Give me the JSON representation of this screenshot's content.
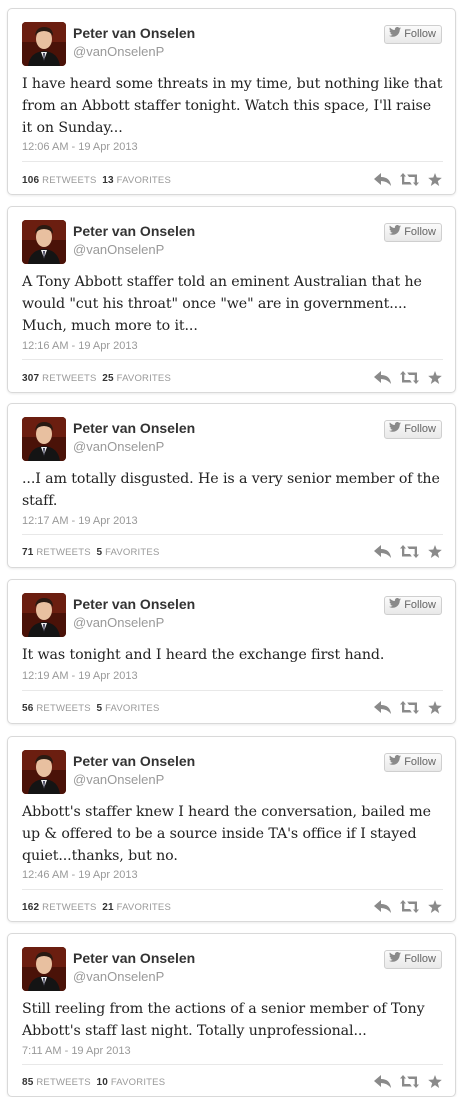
{
  "labels": {
    "follow": "Follow",
    "retweets": "RETWEETS",
    "favorites": "FAVORITES"
  },
  "colors": {
    "icon_gray": "#8a8a8a",
    "twitter_bird": "#8a8a8a"
  },
  "tweets": [
    {
      "name": "Peter van Onselen",
      "handle": "@vanOnselenP",
      "text": "I have heard some threats in my time, but nothing like that from an Abbott staffer tonight. Watch this space, I'll raise it on Sunday...",
      "time": "12:06 AM - 19 Apr 2013",
      "retweets": "106",
      "favorites": "13"
    },
    {
      "name": "Peter van Onselen",
      "handle": "@vanOnselenP",
      "text": "A Tony Abbott staffer told an eminent Australian that he would \"cut his throat\" once \"we\" are in government.... Much, much more to it...",
      "time": "12:16 AM - 19 Apr 2013",
      "retweets": "307",
      "favorites": "25"
    },
    {
      "name": "Peter van Onselen",
      "handle": "@vanOnselenP",
      "text": "...I am totally disgusted. He is a very senior member of the staff.",
      "time": "12:17 AM - 19 Apr 2013",
      "retweets": "71",
      "favorites": "5"
    },
    {
      "name": "Peter van Onselen",
      "handle": "@vanOnselenP",
      "text": "It was tonight and I heard the exchange first hand.",
      "time": "12:19 AM - 19 Apr 2013",
      "retweets": "56",
      "favorites": "5"
    },
    {
      "name": "Peter van Onselen",
      "handle": "@vanOnselenP",
      "text": "Abbott's staffer knew I heard the conversation, bailed me up & offered to be a source inside TA's office if I stayed quiet...thanks, but no.",
      "time": "12:46 AM - 19 Apr 2013",
      "retweets": "162",
      "favorites": "21"
    },
    {
      "name": "Peter van Onselen",
      "handle": "@vanOnselenP",
      "text": "Still reeling from the actions of a senior member of Tony Abbott's staff last night. Totally unprofessional...",
      "time": "7:11 AM - 19 Apr 2013",
      "retweets": "85",
      "favorites": "10"
    }
  ]
}
